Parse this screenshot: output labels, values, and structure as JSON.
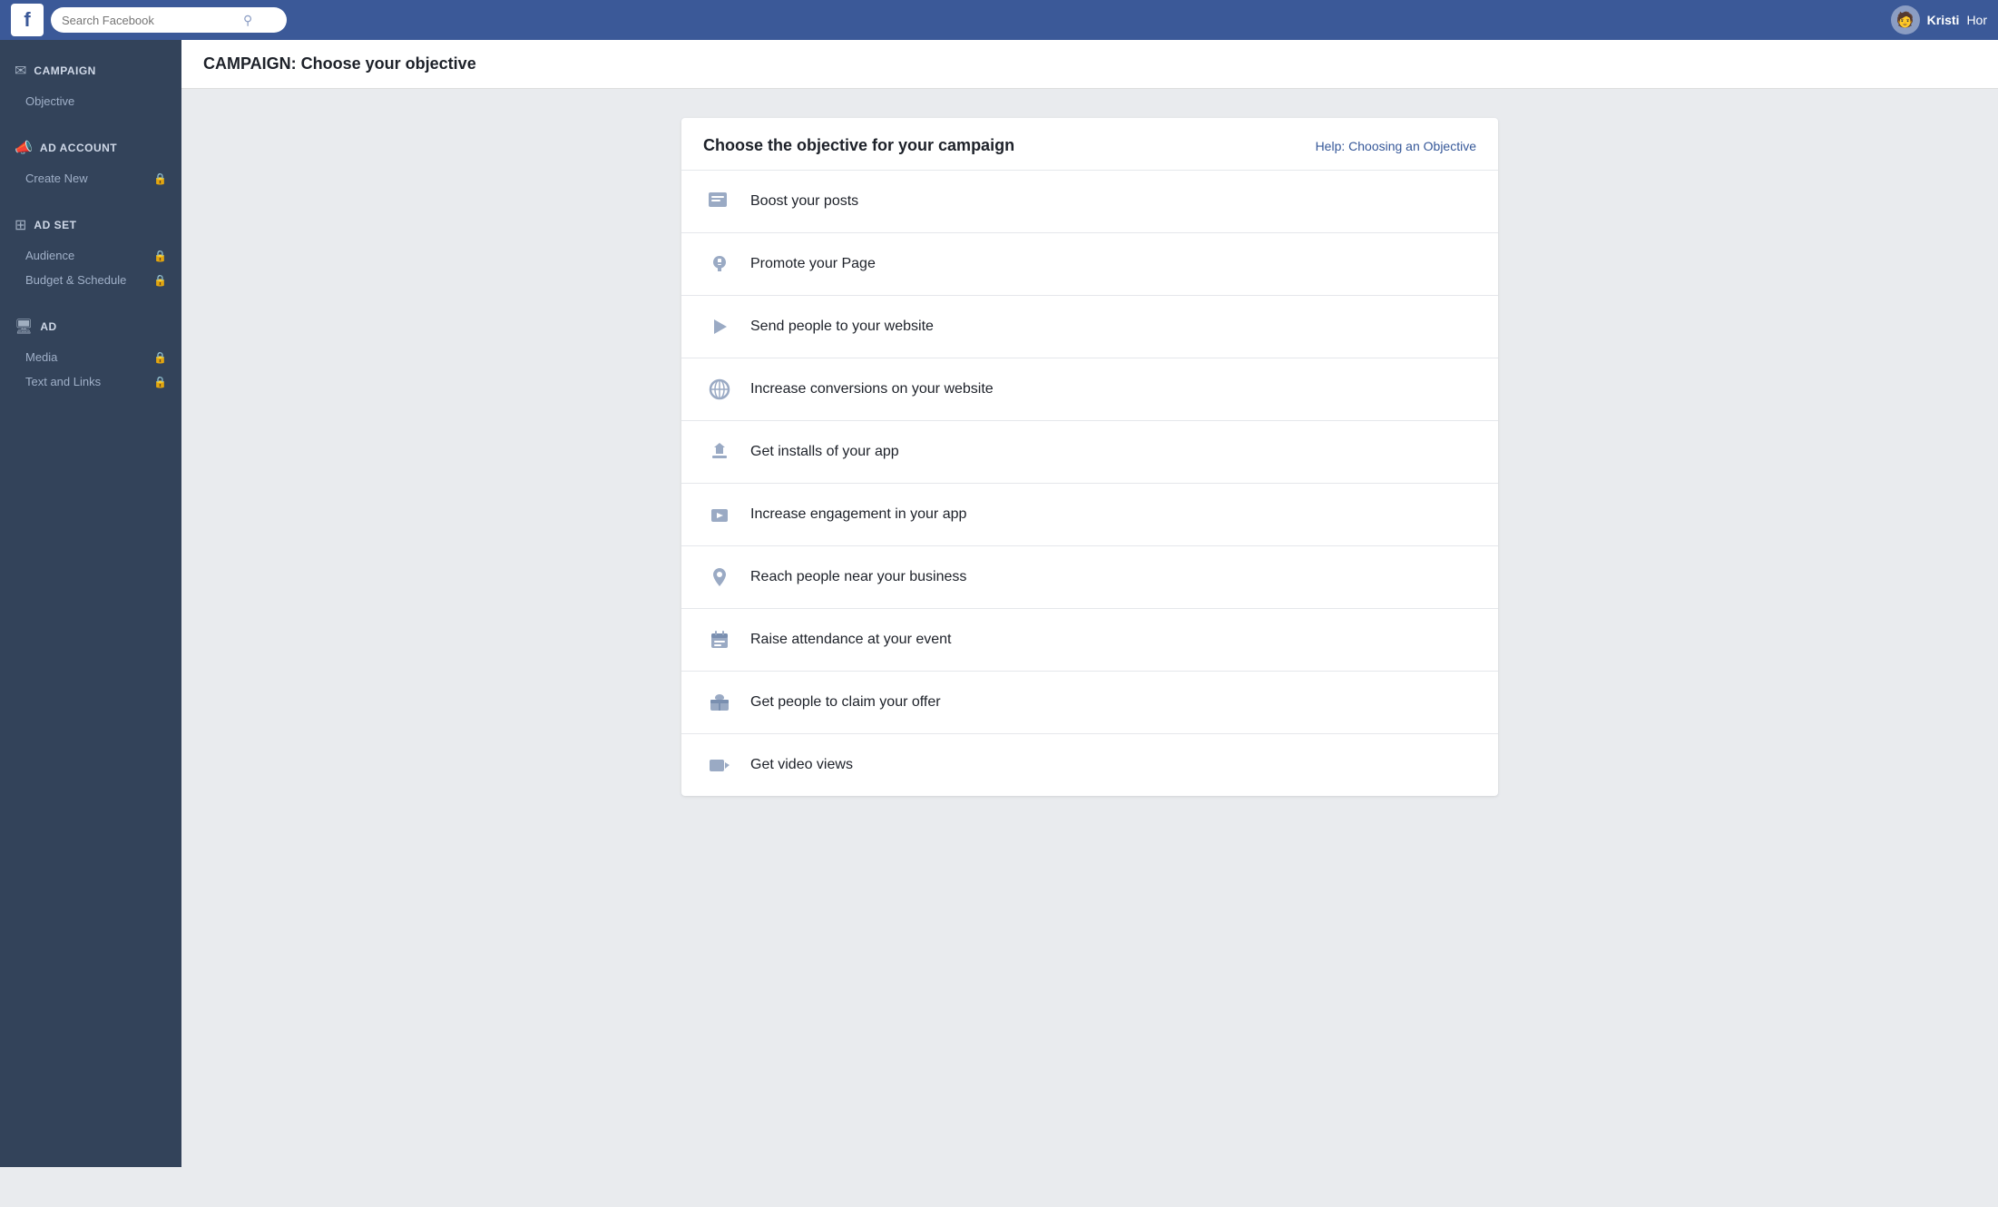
{
  "topnav": {
    "logo": "f",
    "search_placeholder": "Search Facebook",
    "username": "Kristi",
    "home_label": "Hor"
  },
  "page_header": {
    "bold": "CAMPAIGN:",
    "rest": " Choose your objective"
  },
  "sidebar": {
    "sections": [
      {
        "id": "campaign",
        "icon": "✉",
        "title": "CAMPAIGN",
        "items": [
          {
            "label": "Objective",
            "locked": false
          }
        ]
      },
      {
        "id": "ad-account",
        "icon": "📣",
        "title": "AD ACCOUNT",
        "items": [
          {
            "label": "Create New",
            "locked": true
          }
        ]
      },
      {
        "id": "ad-set",
        "icon": "⊞",
        "title": "AD SET",
        "items": [
          {
            "label": "Audience",
            "locked": true
          },
          {
            "label": "Budget & Schedule",
            "locked": true
          }
        ]
      },
      {
        "id": "ad",
        "icon": "🖥",
        "title": "AD",
        "items": [
          {
            "label": "Media",
            "locked": true
          },
          {
            "label": "Text and Links",
            "locked": true
          }
        ]
      }
    ]
  },
  "card": {
    "title": "Choose the objective for your campaign",
    "help_link": "Help: Choosing an Objective",
    "objectives": [
      {
        "id": "boost-posts",
        "icon": "📋",
        "label": "Boost your posts"
      },
      {
        "id": "promote-page",
        "icon": "👍",
        "label": "Promote your Page"
      },
      {
        "id": "send-to-website",
        "icon": "↗",
        "label": "Send people to your website"
      },
      {
        "id": "increase-conversions",
        "icon": "🌐",
        "label": "Increase conversions on your website"
      },
      {
        "id": "app-installs",
        "icon": "📦",
        "label": "Get installs of your app"
      },
      {
        "id": "app-engagement",
        "icon": "🎮",
        "label": "Increase engagement in your app"
      },
      {
        "id": "local-awareness",
        "icon": "📍",
        "label": "Reach people near your business"
      },
      {
        "id": "event-attendance",
        "icon": "📅",
        "label": "Raise attendance at your event"
      },
      {
        "id": "offer-claims",
        "icon": "🎁",
        "label": "Get people to claim your offer"
      },
      {
        "id": "video-views",
        "icon": "🎬",
        "label": "Get video views"
      }
    ]
  }
}
